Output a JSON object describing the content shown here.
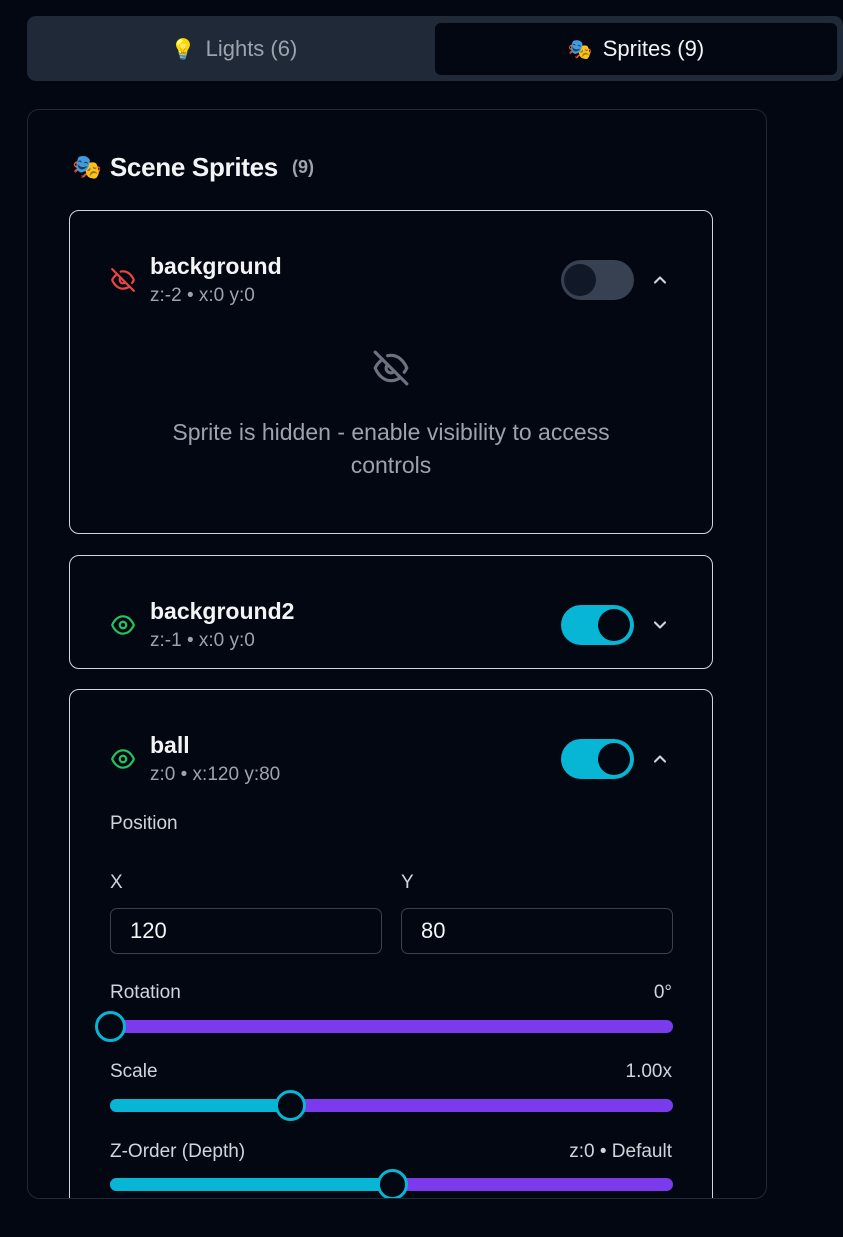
{
  "tabs": [
    {
      "emoji": "💡",
      "label": "Lights (6)",
      "active": false
    },
    {
      "emoji": "🎭",
      "label": "Sprites (9)",
      "active": true
    }
  ],
  "panel": {
    "emoji": "🎭",
    "title": "Scene Sprites",
    "count": "(9)"
  },
  "sprites": [
    {
      "name": "background",
      "meta": "z:-2 • x:0 y:0",
      "visible": false,
      "expanded": true,
      "hidden_message": "Sprite is hidden - enable visibility to access controls"
    },
    {
      "name": "background2",
      "meta": "z:-1 • x:0 y:0",
      "visible": true,
      "expanded": false
    },
    {
      "name": "ball",
      "meta": "z:0 • x:120 y:80",
      "visible": true,
      "expanded": true,
      "position_label": "Position",
      "x_label": "X",
      "y_label": "Y",
      "x_value": "120",
      "y_value": "80",
      "rotation": {
        "label": "Rotation",
        "value_text": "0°",
        "fraction": 0.0
      },
      "scale": {
        "label": "Scale",
        "value_text": "1.00x",
        "fraction": 0.32
      },
      "zorder": {
        "label": "Z-Order (Depth)",
        "value_text": "z:0 • Default",
        "fraction": 0.5
      }
    }
  ],
  "colors": {
    "accent_cyan": "#06b6d4",
    "track_purple": "#7c3aed",
    "hidden_red": "#ef4444",
    "visible_green": "#22c55e"
  }
}
